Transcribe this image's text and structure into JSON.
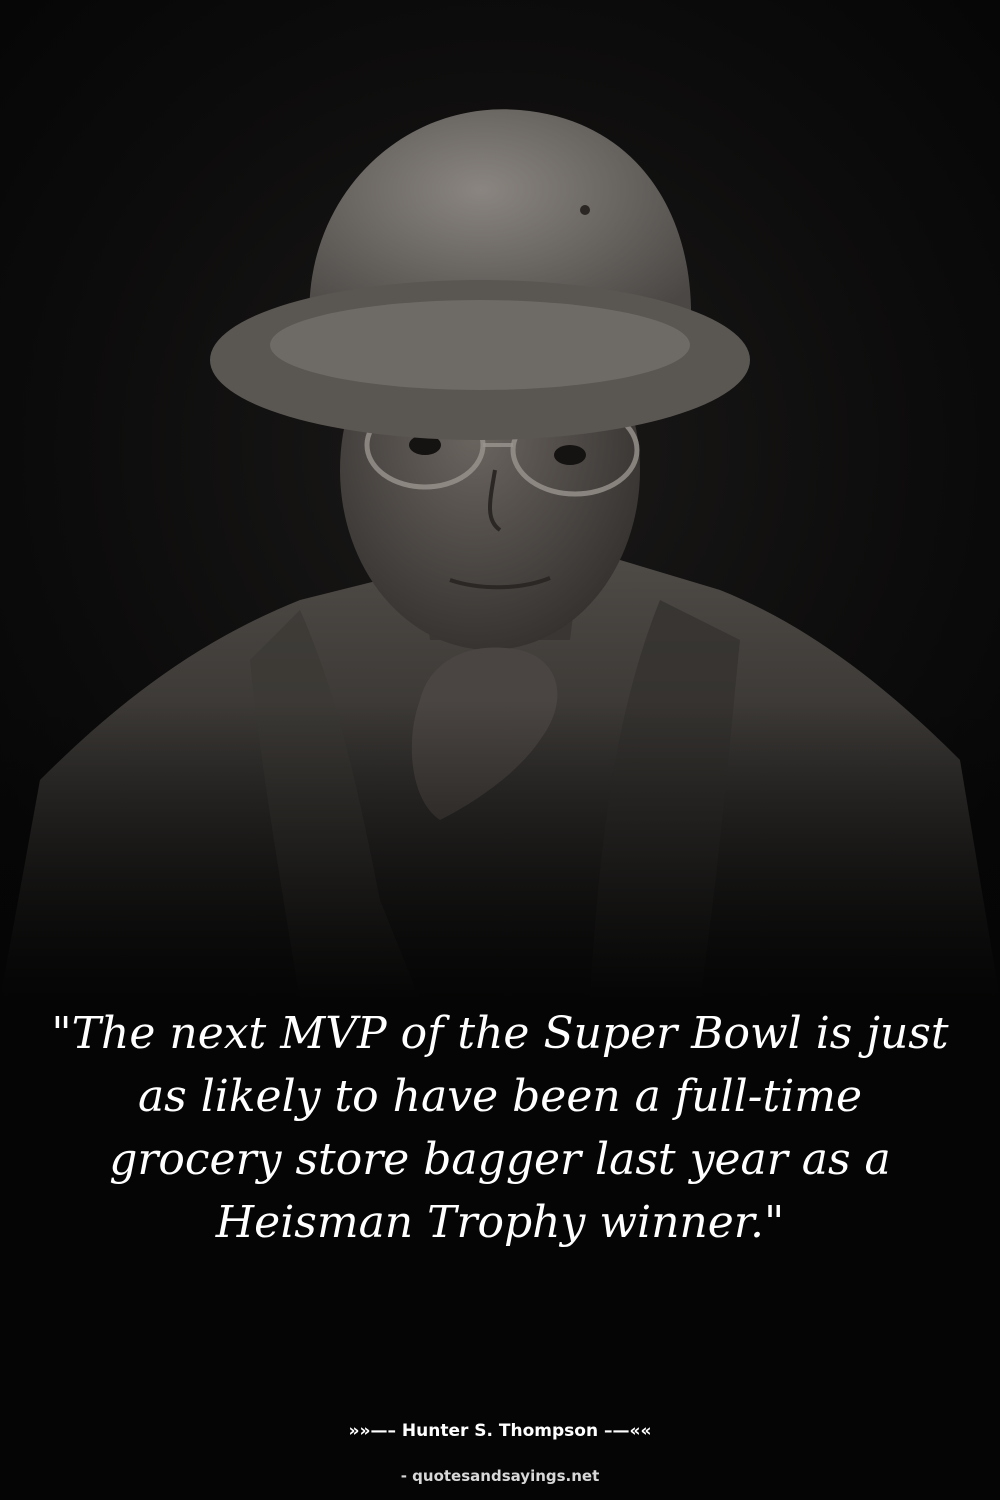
{
  "quote": {
    "text": "\"The next MVP of the Super Bowl is just as likely to have been a full-time grocery store bagger last year as a Heisman Trophy winner.\"",
    "attribution": "»»—– Hunter S. Thompson –—««"
  },
  "footer": {
    "source": "- quotesandsayings.net"
  },
  "colors": {
    "background": "#050505",
    "text": "#ffffff",
    "photo_tone": "#6e6a66"
  },
  "photo": {
    "subject": "portrait-photo"
  }
}
